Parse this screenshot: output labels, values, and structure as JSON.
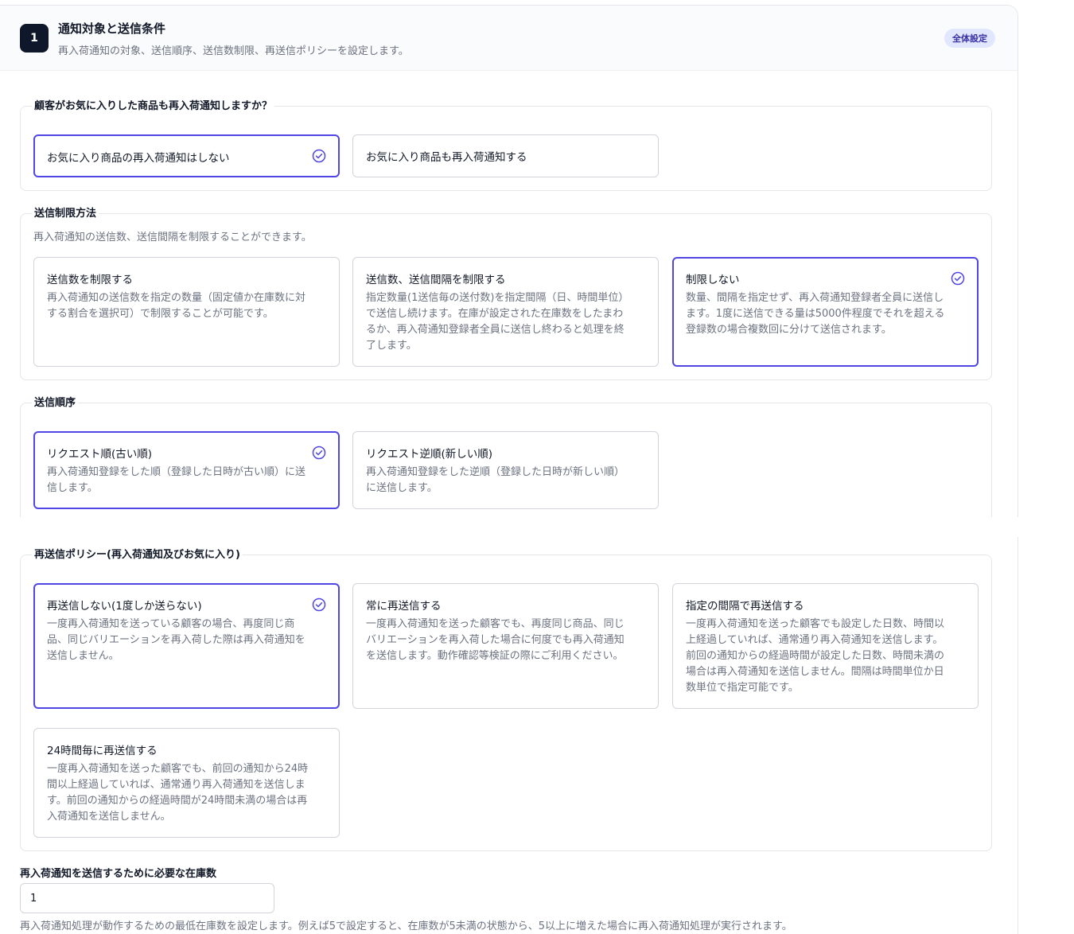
{
  "header": {
    "step_number": "1",
    "title": "通知対象と送信条件",
    "description": "再入荷通知の対象、送信順序、送信数制限、再送信ポリシーを設定します。",
    "scope_label": "全体設定"
  },
  "favorites": {
    "legend": "顧客がお気に入りした商品も再入荷通知しますか？",
    "options": [
      {
        "title": "お気に入り商品の再入荷通知はしない",
        "selected": true
      },
      {
        "title": "お気に入り商品も再入荷通知する",
        "selected": false
      }
    ]
  },
  "send_limit": {
    "legend": "送信制限方法",
    "help": "再入荷通知の送信数、送信間隔を制限することができます。",
    "options": [
      {
        "title": "送信数を制限する",
        "desc": "再入荷通知の送信数を指定の数量（固定値か在庫数に対する割合を選択可）で制限することが可能です。",
        "selected": false
      },
      {
        "title": "送信数、送信間隔を制限する",
        "desc": "指定数量(1送信毎の送付数)を指定間隔（日、時間単位）で送信し続けます。在庫が設定された在庫数をしたまわるか、再入荷通知登録者全員に送信し終わると処理を終了します。",
        "selected": false
      },
      {
        "title": "制限しない",
        "desc": "数量、間隔を指定せず、再入荷通知登録者全員に送信します。1度に送信できる量は5000件程度でそれを超える登録数の場合複数回に分けて送信されます。",
        "selected": true
      }
    ]
  },
  "send_order": {
    "legend": "送信順序",
    "options": [
      {
        "title": "リクエスト順(古い順)",
        "desc": "再入荷通知登録をした順（登録した日時が古い順）に送信します。",
        "selected": true
      },
      {
        "title": "リクエスト逆順(新しい順)",
        "desc": "再入荷通知登録をした逆順（登録した日時が新しい順）に送信します。",
        "selected": false
      }
    ]
  },
  "resend_policy": {
    "legend": "再送信ポリシー(再入荷通知及びお気に入り)",
    "options": [
      {
        "title": "再送信しない(1度しか送らない)",
        "desc": "一度再入荷通知を送っている顧客の場合、再度同じ商品、同じバリエーションを再入荷した際は再入荷通知を送信しません。",
        "selected": true
      },
      {
        "title": "常に再送信する",
        "desc": "一度再入荷通知を送った顧客でも、再度同じ商品、同じバリエーションを再入荷した場合に何度でも再入荷通知を送信します。動作確認等検証の際にご利用ください。",
        "selected": false
      },
      {
        "title": "指定の間隔で再送信する",
        "desc": "一度再入荷通知を送った顧客でも設定した日数、時間以上経過していれば、通常通り再入荷通知を送信します。前回の通知からの経過時間が設定した日数、時間未満の場合は再入荷通知を送信しません。間隔は時間単位か日数単位で指定可能です。",
        "selected": false
      },
      {
        "title": "24時間毎に再送信する",
        "desc": "一度再入荷通知を送った顧客でも、前回の通知から24時間以上経過していれば、通常通り再入荷通知を送信します。前回の通知からの経過時間が24時間未満の場合は再入荷通知を送信しません。",
        "selected": false
      }
    ]
  },
  "min_stock": {
    "label": "再入荷通知を送信するために必要な在庫数",
    "value": "1",
    "help": "再入荷通知処理が動作するための最低在庫数を設定します。例えば5で設定すると、在庫数が5未満の状態から、5以上に増えた場合に再入荷通知処理が実行されます。"
  },
  "colors": {
    "accent": "#4f46e5",
    "badge_bg": "#0f172a",
    "pill_bg": "#e0e7ff"
  }
}
